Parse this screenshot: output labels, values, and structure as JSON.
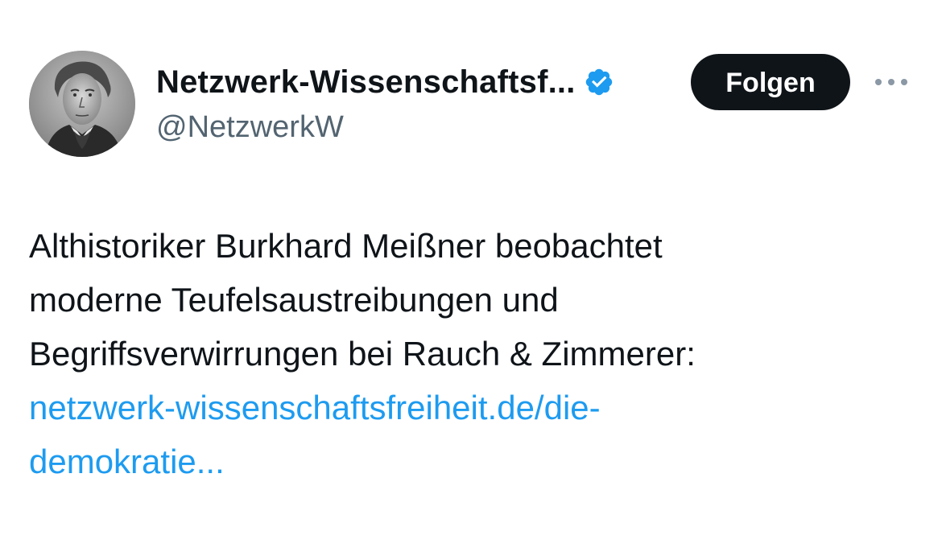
{
  "author": {
    "display_name": "Netzwerk-Wissenschaftsf...",
    "handle": "@NetzwerkW",
    "verified_icon": "verified-badge-icon",
    "avatar": "portrait-avatar"
  },
  "actions": {
    "follow_label": "Folgen",
    "more_icon": "more-horizontal-icon"
  },
  "tweet": {
    "text_lines": [
      "Althistoriker Burkhard Meißner beobachtet",
      "moderne Teufelsaustreibungen und",
      "Begriffsverwirrungen bei Rauch & Zimmerer:"
    ],
    "link_lines": [
      "netzwerk-wissenschaftsfreiheit.de/die-",
      "demokratie..."
    ]
  },
  "colors": {
    "text": "#0f1419",
    "secondary": "#536471",
    "link": "#1d9bf0",
    "button_bg": "#0f1419",
    "verified": "#1d9bf0"
  }
}
